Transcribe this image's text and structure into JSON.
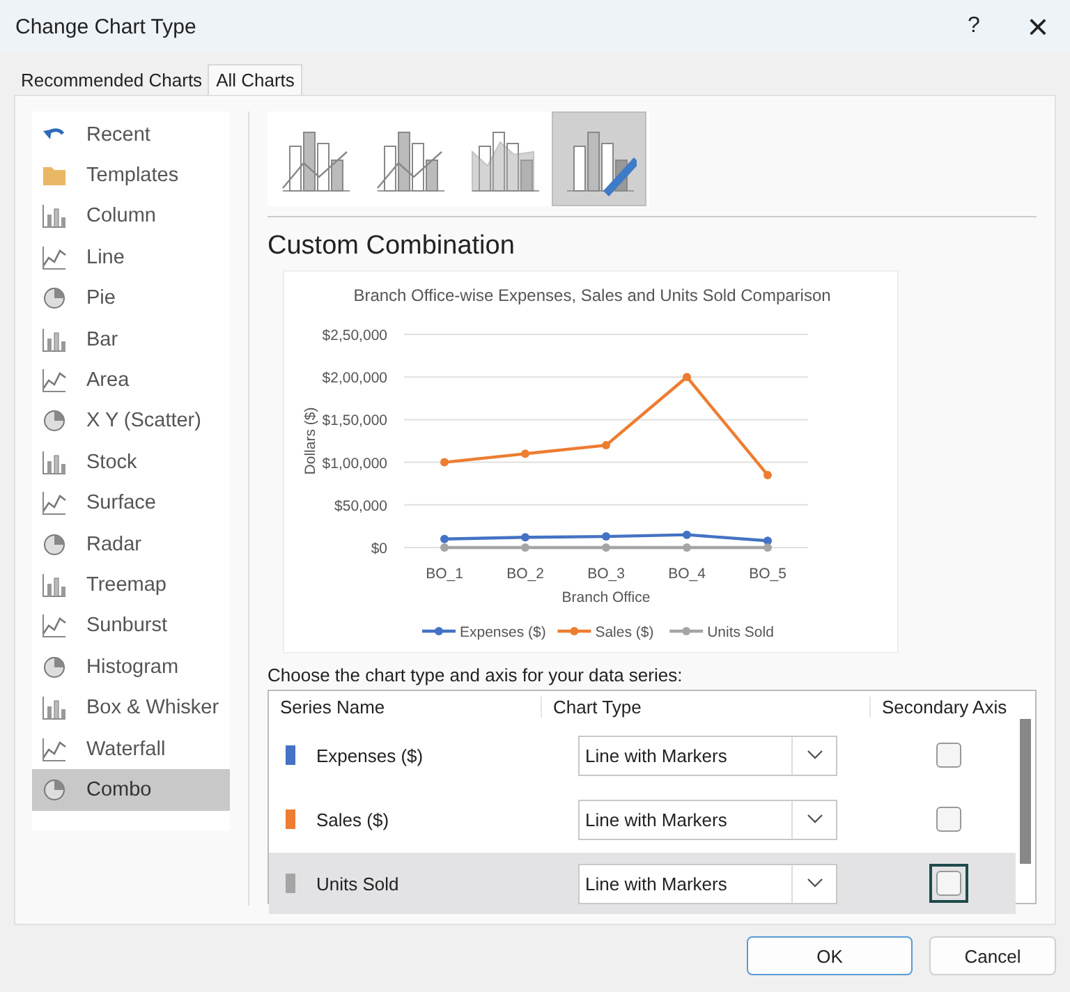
{
  "window": {
    "title": "Change Chart Type",
    "help": "?",
    "close": "×"
  },
  "tabs": [
    {
      "label": "Recommended Charts",
      "selected": false
    },
    {
      "label": "All Charts",
      "selected": true
    }
  ],
  "chart_types": [
    {
      "label": "Recent",
      "selected": false
    },
    {
      "label": "Templates",
      "selected": false
    },
    {
      "label": "Column",
      "selected": false
    },
    {
      "label": "Line",
      "selected": false
    },
    {
      "label": "Pie",
      "selected": false
    },
    {
      "label": "Bar",
      "selected": false
    },
    {
      "label": "Area",
      "selected": false
    },
    {
      "label": "X Y (Scatter)",
      "selected": false
    },
    {
      "label": "Stock",
      "selected": false
    },
    {
      "label": "Surface",
      "selected": false
    },
    {
      "label": "Radar",
      "selected": false
    },
    {
      "label": "Treemap",
      "selected": false
    },
    {
      "label": "Sunburst",
      "selected": false
    },
    {
      "label": "Histogram",
      "selected": false
    },
    {
      "label": "Box & Whisker",
      "selected": false
    },
    {
      "label": "Waterfall",
      "selected": false
    },
    {
      "label": "Combo",
      "selected": true
    }
  ],
  "subtypes": [
    {
      "selected": false
    },
    {
      "selected": false
    },
    {
      "selected": false
    },
    {
      "selected": true
    }
  ],
  "heading": "Custom Combination",
  "preview": {
    "chart_data": {
      "type": "line",
      "title": "Branch Office-wise Expenses, Sales and Units Sold Comparison",
      "xlabel": "Branch Office",
      "ylabel": "Dollars ($)",
      "categories": [
        "BO_1",
        "BO_2",
        "BO_3",
        "BO_4",
        "BO_5"
      ],
      "series": [
        {
          "name": "Expenses ($)",
          "color": "#4472c4",
          "marker": "circle",
          "values": [
            10000,
            12000,
            13000,
            15000,
            8000
          ]
        },
        {
          "name": "Sales ($)",
          "color": "#ed7d31",
          "marker": "circle",
          "values": [
            100000,
            110000,
            120000,
            200000,
            85000
          ]
        },
        {
          "name": "Units Sold",
          "color": "#a5a5a5",
          "marker": "circle",
          "values": [
            0,
            0,
            0,
            0,
            0
          ]
        }
      ],
      "grid": true,
      "legend": true,
      "ylim": [
        0,
        250000
      ],
      "yticks": [
        {
          "value": 0,
          "label": "$0"
        },
        {
          "value": 50000,
          "label": "$50,000"
        },
        {
          "value": 100000,
          "label": "$1,00,000"
        },
        {
          "value": 150000,
          "label": "$1,50,000"
        },
        {
          "value": 200000,
          "label": "$2,00,000"
        },
        {
          "value": 250000,
          "label": "$2,50,000"
        }
      ]
    }
  },
  "series_prompt": "Choose the chart type and axis for your data series:",
  "series_table": {
    "columns": [
      "Series Name",
      "Chart Type",
      "Secondary Axis"
    ],
    "rows": [
      {
        "name": "Expenses ($)",
        "color": "#4472c4",
        "chart_type": "Line with Markers",
        "secondary_axis": false,
        "selected": false
      },
      {
        "name": "Sales ($)",
        "color": "#ed7d31",
        "chart_type": "Line with Markers",
        "secondary_axis": false,
        "selected": false
      },
      {
        "name": "Units Sold",
        "color": "#a5a5a5",
        "chart_type": "Line with Markers",
        "secondary_axis": false,
        "selected": true
      }
    ]
  },
  "buttons": [
    {
      "label": "OK",
      "default": true
    },
    {
      "label": "Cancel",
      "default": false
    }
  ]
}
